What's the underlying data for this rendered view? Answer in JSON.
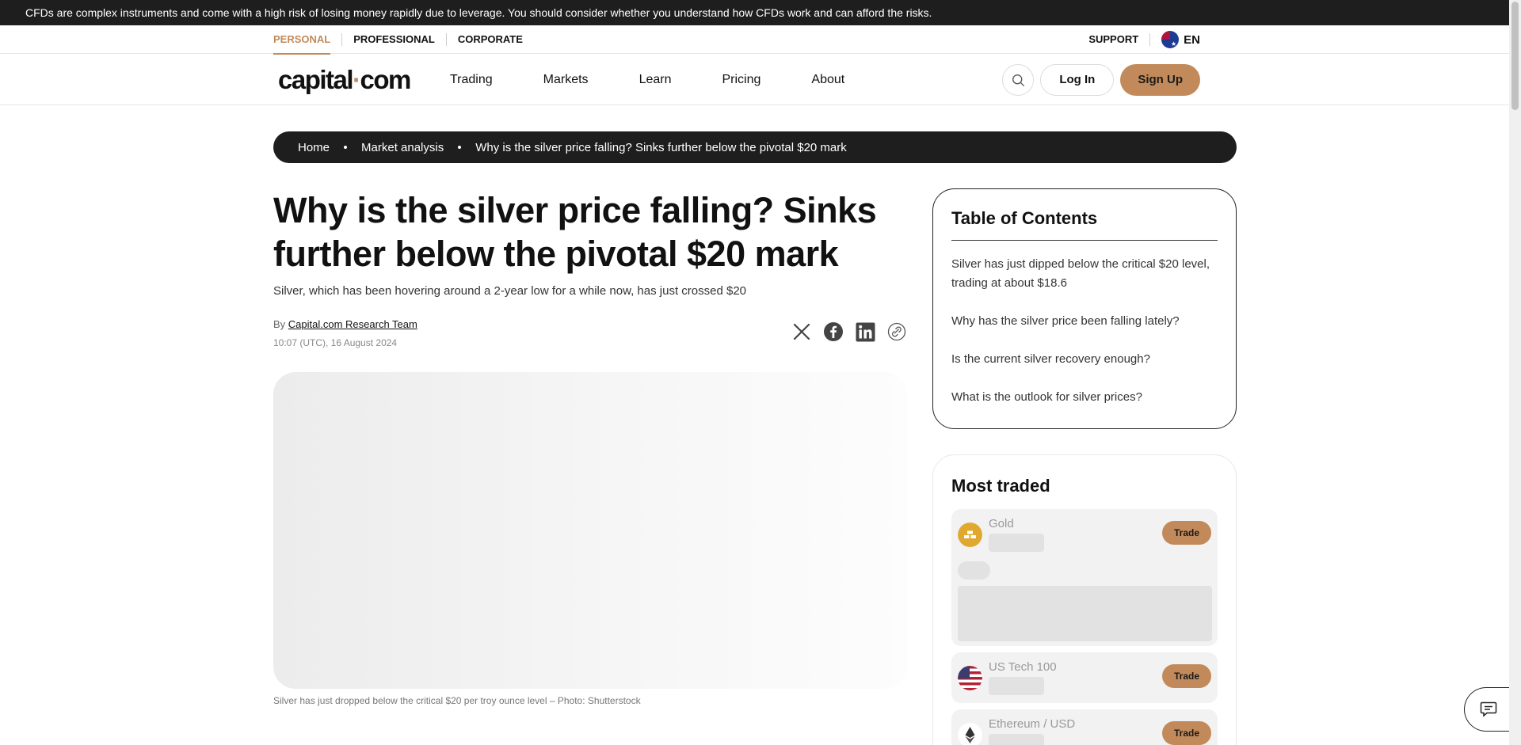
{
  "risk_warning": "CFDs are complex instruments and come with a high risk of losing money rapidly due to leverage. You should consider whether you understand how CFDs work and can afford the risks.",
  "segments": [
    "PERSONAL",
    "PROFESSIONAL",
    "CORPORATE"
  ],
  "support_label": "SUPPORT",
  "language": "EN",
  "logo": {
    "left": "capital",
    "dot": "·",
    "right": "com"
  },
  "nav": [
    "Trading",
    "Markets",
    "Learn",
    "Pricing",
    "About"
  ],
  "login_label": "Log In",
  "signup_label": "Sign Up",
  "breadcrumb": [
    "Home",
    "Market analysis",
    "Why is the silver price falling? Sinks further below the pivotal $20 mark"
  ],
  "article": {
    "title": "Why is the silver price falling? Sinks further below the pivotal $20 mark",
    "subtitle": "Silver, which has been hovering around a 2-year low for a while now, has just crossed $20",
    "by": "By",
    "author": "Capital.com Research Team",
    "date": "10:07 (UTC), 16 August 2024",
    "caption": "Silver has just dropped below the critical $20 per troy ounce level – Photo: Shutterstock"
  },
  "share_icons": [
    "x-icon",
    "facebook-icon",
    "linkedin-icon",
    "copy-link-icon"
  ],
  "toc": {
    "title": "Table of Contents",
    "items": [
      "Silver has just dipped below the critical $20 level, trading at about $18.6",
      "Why has the silver price been falling lately?",
      "Is the current silver recovery enough?",
      "What is the outlook for silver prices?"
    ]
  },
  "most_traded": {
    "title": "Most traded",
    "trade_label": "Trade",
    "assets": [
      {
        "name": "Gold",
        "icon": "gold-icon",
        "color": "#e0a82e"
      },
      {
        "name": "US Tech 100",
        "icon": "us-flag-icon",
        "color": "#b22234"
      },
      {
        "name": "Ethereum / USD",
        "icon": "ethereum-icon",
        "color": "#333333"
      }
    ]
  },
  "colors": {
    "accent": "#c28a5a",
    "dark": "#1e1e1e"
  }
}
